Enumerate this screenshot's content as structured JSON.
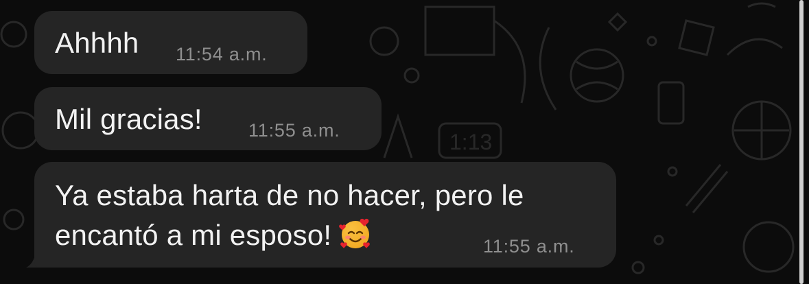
{
  "messages": [
    {
      "text": "Ahhhh",
      "time": "11:54 a.m."
    },
    {
      "text": "Mil gracias!",
      "time": "11:55 a.m."
    },
    {
      "lines": [
        "Ya estaba harta de no hacer, pero le",
        "encantó a mi esposo!"
      ],
      "emoji": "smiling-face-with-hearts",
      "time": "11:55 a.m."
    }
  ],
  "colors": {
    "background": "#0c0c0c",
    "bubble": "#252525",
    "text": "#f2f2f2",
    "time": "#8f8f8f"
  }
}
